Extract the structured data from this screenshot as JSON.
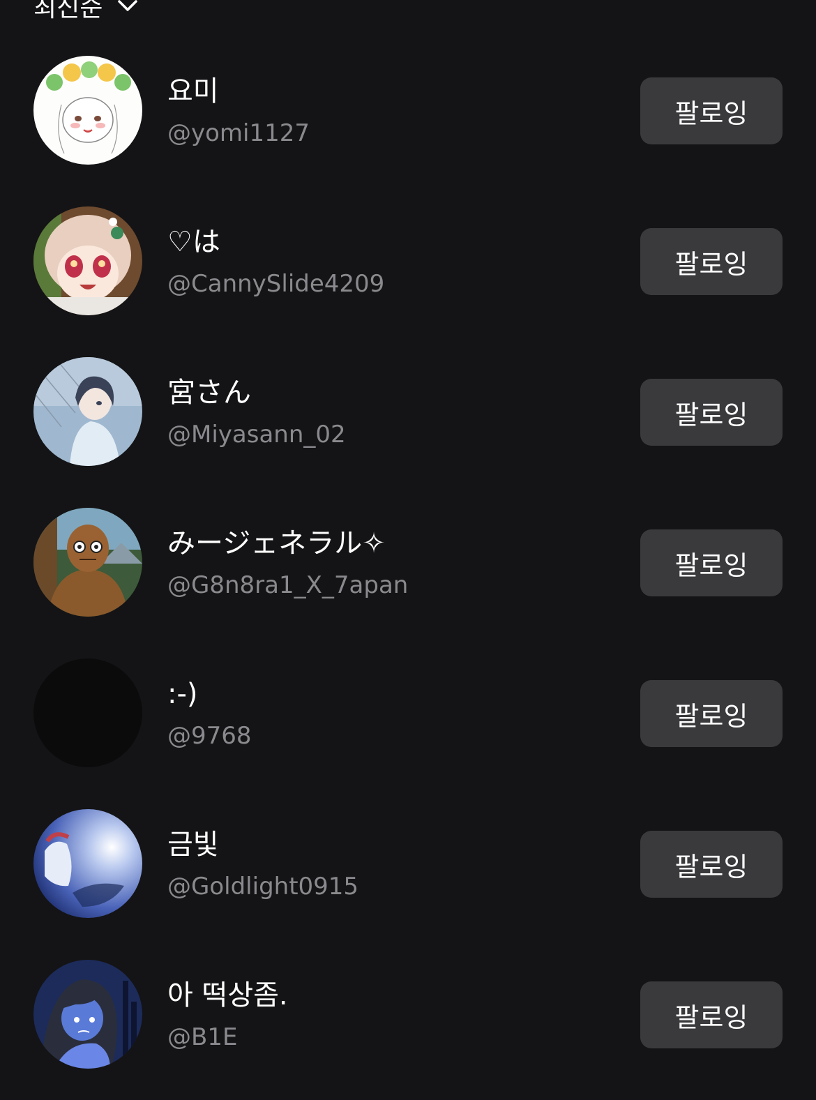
{
  "sort": {
    "label": "최신순",
    "icon": "chevron-down-icon"
  },
  "colors": {
    "background": "#141416",
    "button_bg": "#3a3a3d",
    "handle_text": "#8a8a8e"
  },
  "users": [
    {
      "name": "요미",
      "handle": "@yomi1127",
      "button": "팔로잉"
    },
    {
      "name": "♡は",
      "handle": "@CannySlide4209",
      "button": "팔로잉"
    },
    {
      "name": "宮さん",
      "handle": "@Miyasann_02",
      "button": "팔로잉"
    },
    {
      "name": "みージェネラル✧",
      "handle": "@G8n8ra1_X_7apan",
      "button": "팔로잉"
    },
    {
      "name": ":-)",
      "handle": "@9768",
      "button": "팔로잉"
    },
    {
      "name": "금빛",
      "handle": "@Goldlight0915",
      "button": "팔로잉"
    },
    {
      "name": "아 떡상좀.",
      "handle": "@B1E",
      "button": "팔로잉"
    }
  ]
}
